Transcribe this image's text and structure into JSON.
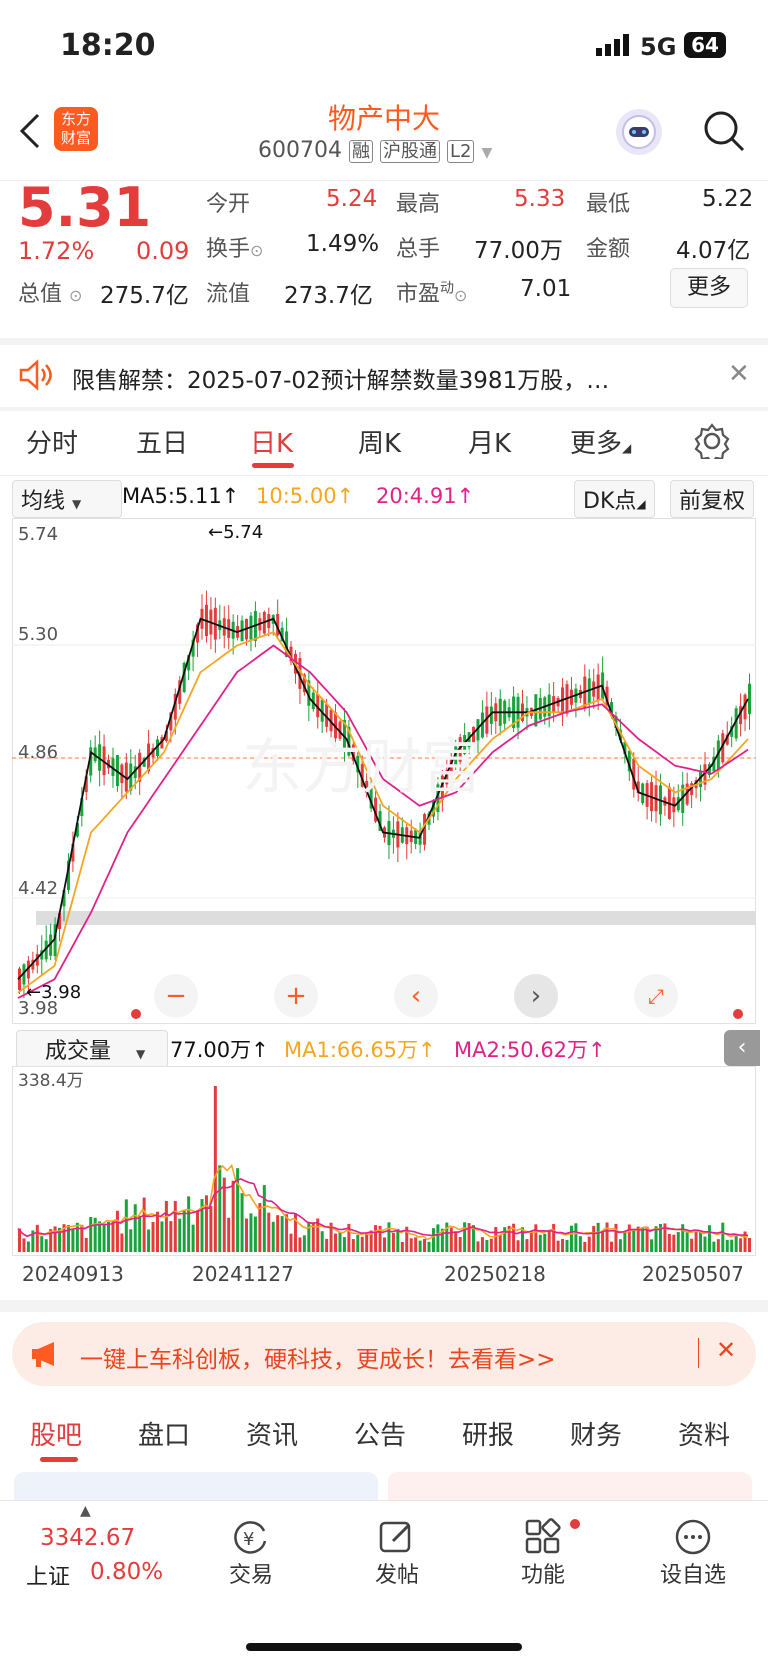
{
  "status_bar": {
    "time": "18:20",
    "network": "5G",
    "battery": "64"
  },
  "header": {
    "logo_text": "东方\n财富",
    "stock_name": "物产中大",
    "stock_code": "600704",
    "tags": [
      "融",
      "沪股通",
      "L2"
    ]
  },
  "quote": {
    "price": "5.31",
    "change_pct": "1.72%",
    "change_amt": "0.09",
    "market_cap_label": "总值",
    "market_cap": "275.7亿",
    "fields": [
      {
        "label": "今开",
        "value": "5.24",
        "color": "red"
      },
      {
        "label": "最高",
        "value": "5.33",
        "color": "red"
      },
      {
        "label": "最低",
        "value": "5.22",
        "color": "normal"
      },
      {
        "label": "换手",
        "value": "1.49%",
        "color": "normal"
      },
      {
        "label": "总手",
        "value": "77.00万",
        "color": "normal"
      },
      {
        "label": "金额",
        "value": "4.07亿",
        "color": "normal"
      },
      {
        "label": "流值",
        "value": "273.7亿",
        "color": "normal"
      },
      {
        "label": "市盈",
        "value": "7.01",
        "color": "normal"
      }
    ],
    "pe_superscript": "动",
    "more_button": "更多"
  },
  "notice": {
    "text": "限售解禁：2025-07-02预计解禁数量3981万股，…"
  },
  "tabs": [
    "分时",
    "五日",
    "日K",
    "周K",
    "月K",
    "更多"
  ],
  "active_tab": "日K",
  "chart_toolbar": {
    "indicator": "均线",
    "ma5": "MA5:5.11↑",
    "ma10": "10:5.00↑",
    "ma20": "20:4.91↑",
    "dk_button": "DK点",
    "adjust_button": "前复权"
  },
  "price_axis": [
    "5.74",
    "5.30",
    "4.86",
    "4.42",
    "3.98"
  ],
  "annotations": {
    "high": "←5.74",
    "low": "←3.98"
  },
  "volume_toolbar": {
    "indicator": "成交量",
    "vol": "77.00万↑",
    "ma1": "MA1:66.65万↑",
    "ma2": "MA2:50.62万↑",
    "max_label": "338.4万"
  },
  "dates": [
    "20240913",
    "20241127",
    "20250218",
    "20250507"
  ],
  "banner": {
    "text": "一键上车科创板，硬科技，更成长！去看看>>"
  },
  "bottom_tabs": [
    "股吧",
    "盘口",
    "资讯",
    "公告",
    "研报",
    "财务",
    "资料"
  ],
  "index": {
    "value": "3342.67",
    "name": "上证",
    "pct": "0.80%"
  },
  "nav": [
    "交易",
    "发帖",
    "功能",
    "设自选"
  ],
  "colors": {
    "up": "#e33c3c",
    "down": "#1aa33c",
    "ma5": "#111111",
    "ma10": "#f4a623",
    "ma20": "#e0218a",
    "accent": "#ff5a1f"
  },
  "chart_data": {
    "type": "candlestick",
    "ylim": [
      3.98,
      5.74
    ],
    "x_labels": [
      "20240913",
      "20241127",
      "20250218",
      "20250507"
    ],
    "ma5_approx": [
      4.05,
      4.2,
      4.9,
      4.8,
      4.95,
      5.4,
      5.35,
      5.4,
      5.1,
      4.95,
      4.6,
      4.58,
      4.9,
      5.05,
      5.05,
      5.1,
      5.15,
      4.75,
      4.7,
      4.85,
      5.1
    ],
    "ma10_approx": [
      4.0,
      4.1,
      4.6,
      4.75,
      4.9,
      5.2,
      5.3,
      5.35,
      5.15,
      5.0,
      4.7,
      4.6,
      4.8,
      4.95,
      5.05,
      5.05,
      5.1,
      4.85,
      4.75,
      4.8,
      4.95
    ],
    "ma20_approx": [
      3.98,
      4.05,
      4.3,
      4.6,
      4.8,
      5.0,
      5.2,
      5.3,
      5.2,
      5.05,
      4.8,
      4.7,
      4.75,
      4.9,
      5.0,
      5.05,
      5.08,
      4.95,
      4.85,
      4.82,
      4.91
    ]
  }
}
